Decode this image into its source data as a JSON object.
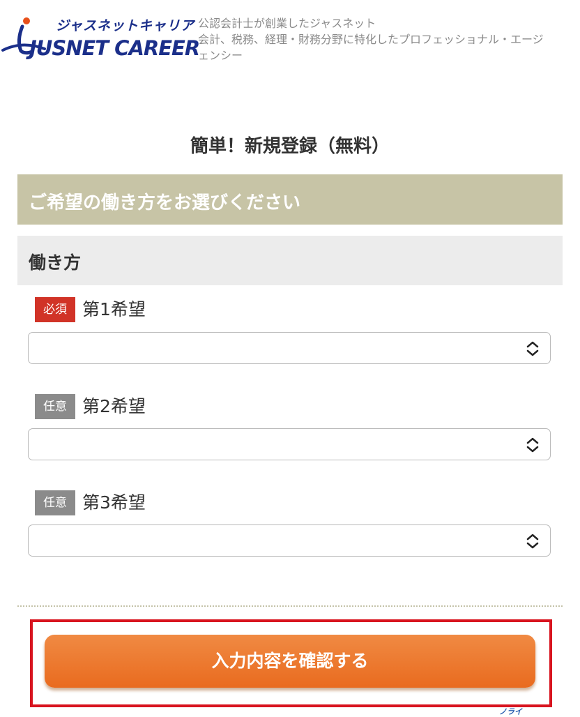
{
  "header": {
    "logo_kana": "ジャスネットキャリア",
    "logo_en": "JUSNET CAREER",
    "tagline_lines": [
      "公認会計士が創業したジャスネット",
      "会計、税務、経理・財務分野に特化したプロフェッショナル・エージ",
      "ェンシー"
    ]
  },
  "form": {
    "title": "簡単！新規登録（無料）",
    "section_heading": "ご希望の働き方をお選びください",
    "subsection_heading": "働き方",
    "fields": [
      {
        "badge": "必須",
        "label": "第1希望",
        "value": ""
      },
      {
        "badge": "任意",
        "label": "第2希望",
        "value": ""
      },
      {
        "badge": "任意",
        "label": "第3希望",
        "value": ""
      }
    ],
    "submit_label": "入力内容を確認する"
  },
  "footer": {
    "partial_logo_text": "ノライ"
  },
  "colors": {
    "section_band": "#c7c4a6",
    "required_badge": "#d13327",
    "optional_badge": "#8b8b8b",
    "submit_button": "#ec7a2e",
    "highlight_box": "#d8141f"
  },
  "icons": {
    "select_arrow": "chevron-up-down-icon",
    "logo_mark": "running-figure-logo-icon"
  }
}
